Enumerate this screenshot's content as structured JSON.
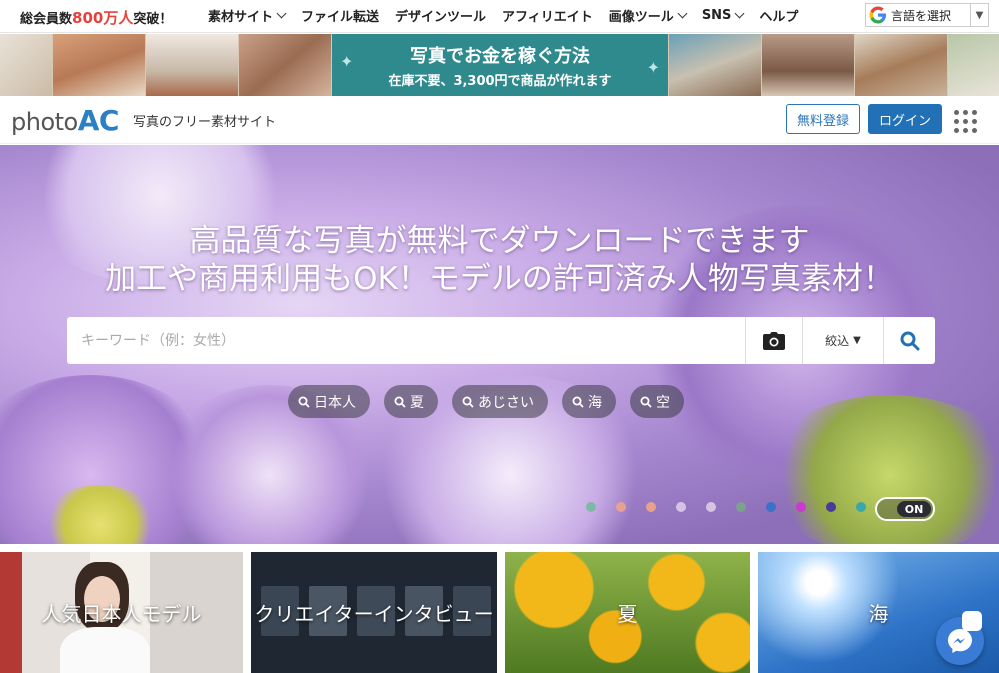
{
  "topbar": {
    "members_prefix": "総会員数",
    "members_count": "800万人",
    "members_suffix": "突破！",
    "nav": [
      {
        "label": "素材サイト",
        "dropdown": true
      },
      {
        "label": "ファイル転送",
        "dropdown": false
      },
      {
        "label": "デザインツール",
        "dropdown": false
      },
      {
        "label": "アフィリエイト",
        "dropdown": false
      },
      {
        "label": "画像ツール",
        "dropdown": true
      },
      {
        "label": "SNS",
        "dropdown": true
      },
      {
        "label": "ヘルプ",
        "dropdown": false
      }
    ],
    "translate_label": "言語を選択",
    "translate_arrow": "▼"
  },
  "banner": {
    "title": "写真でお金を稼ぐ方法",
    "subtitle": "在庫不要、3,300円で商品が作れます"
  },
  "header": {
    "logo_photo": "photo",
    "logo_ac": "AC",
    "tagline": "写真のフリー素材サイト",
    "register_label": "無料登録",
    "login_label": "ログイン"
  },
  "hero": {
    "headline_1": "高品質な写真が無料でダウンロードできます",
    "headline_2": "加工や商用利用もOK！モデルの許可済み人物写真素材！",
    "search_placeholder": "キーワード（例：女性）",
    "filter_label": "絞込",
    "filter_arrow": "▼",
    "chips": [
      "日本人",
      "夏",
      "あじさい",
      "海",
      "空"
    ],
    "slide_dot_colors": [
      "#7fb8a5",
      "#e8a090",
      "#e8a090",
      "#d6c3e3",
      "#d6c3e3",
      "#7ea090",
      "#3a72c8",
      "#c83ad0",
      "#4a3a9a",
      "#3aa8a8"
    ],
    "toggle_label": "ON"
  },
  "cards": [
    {
      "label": "人気日本人モデル",
      "color": "#c9c2bd"
    },
    {
      "label": "クリエイターインタビュー",
      "color": "#2a3340"
    },
    {
      "label": "夏",
      "color": "#6f9a2e"
    },
    {
      "label": "海",
      "color": "#3f86d6"
    }
  ]
}
